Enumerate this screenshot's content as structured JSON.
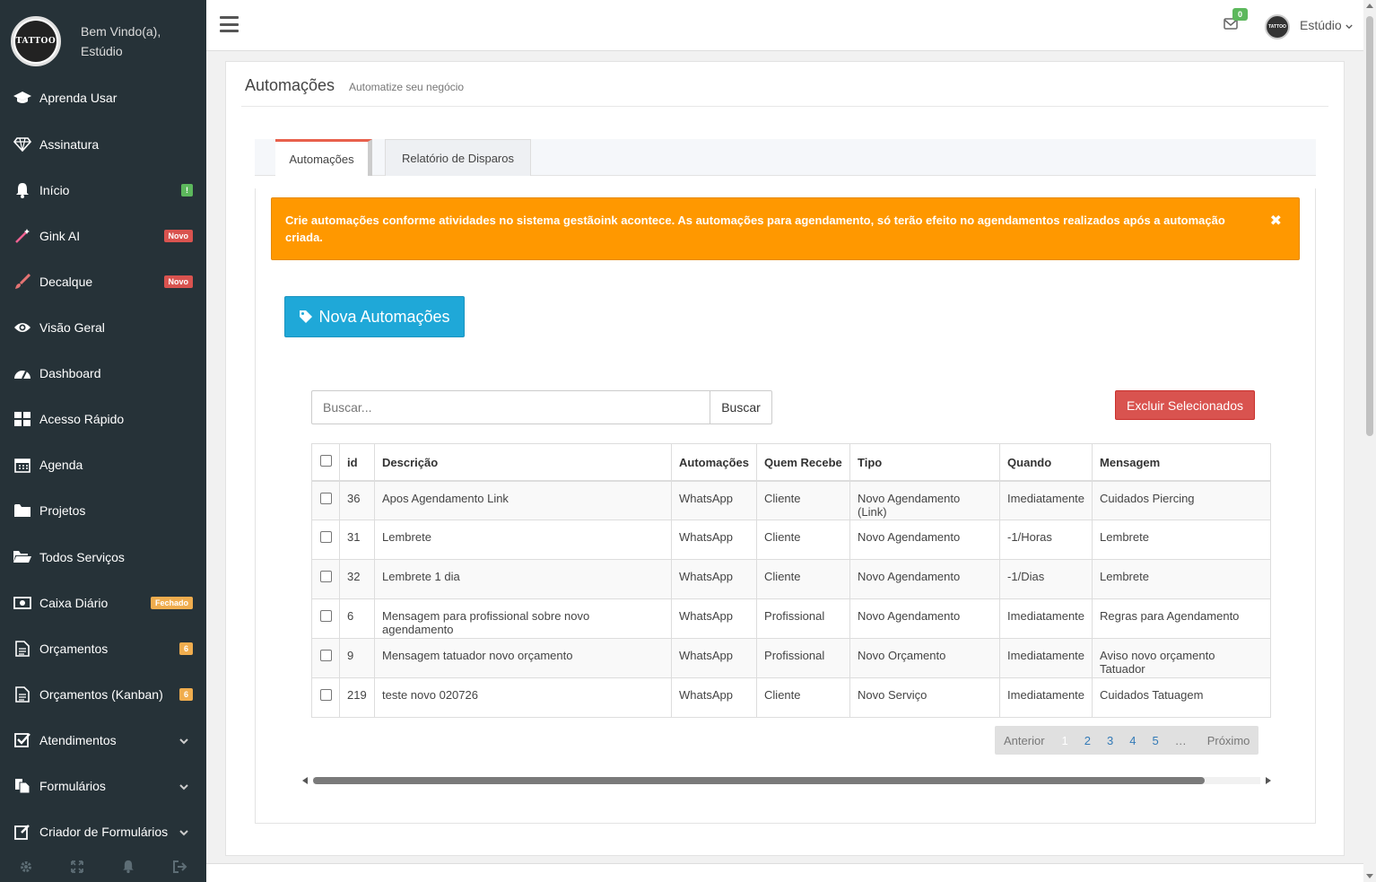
{
  "sidebar": {
    "welcome_line1": "Bem Vindo(a),",
    "welcome_line2": "Estúdio",
    "logo_text": "TATTOO",
    "items": [
      {
        "label": "Aprenda Usar",
        "icon": "graduation-cap-icon"
      },
      {
        "label": "Assinatura",
        "icon": "diamond-icon"
      },
      {
        "label": "Início",
        "icon": "bell-icon",
        "badge": "!"
      },
      {
        "label": "Gink AI",
        "icon": "magic-wand-icon",
        "badge": "Novo"
      },
      {
        "label": "Decalque",
        "icon": "paintbrush-icon",
        "badge": "Novo"
      },
      {
        "label": "Visão Geral",
        "icon": "eye-icon"
      },
      {
        "label": "Dashboard",
        "icon": "dashboard-icon"
      },
      {
        "label": "Acesso Rápido",
        "icon": "grid-icon"
      },
      {
        "label": "Agenda",
        "icon": "calendar-icon"
      },
      {
        "label": "Projetos",
        "icon": "folder-icon"
      },
      {
        "label": "Todos Serviços",
        "icon": "folder-open-icon"
      },
      {
        "label": "Caixa Diário",
        "icon": "money-icon",
        "badge": "Fechado"
      },
      {
        "label": "Orçamentos",
        "icon": "document-icon",
        "badge": "6"
      },
      {
        "label": "Orçamentos (Kanban)",
        "icon": "document-icon",
        "badge": "6"
      },
      {
        "label": "Atendimentos",
        "icon": "check-square-icon"
      },
      {
        "label": "Formulários",
        "icon": "files-icon"
      },
      {
        "label": "Criador de Formulários",
        "icon": "edit-icon"
      }
    ],
    "footer_icons": [
      "gear-icon",
      "fullscreen-icon",
      "bell-icon",
      "logout-icon"
    ]
  },
  "topbar": {
    "mail_count": "0",
    "user_name": "Estúdio",
    "avatar_text": "TATTOO"
  },
  "page": {
    "title": "Automações",
    "subtitle": "Automatize seu negócio",
    "tabs": [
      "Automações",
      "Relatório de Disparos"
    ],
    "alert": "Crie automações conforme atividades no sistema gestãoink acontece. As automações para agendamento, só terão efeito no agendamentos realizados após a automação criada.",
    "alert_close": "✖",
    "new_button": "Nova Automações",
    "search_placeholder": "Buscar...",
    "search_button": "Buscar",
    "delete_button": "Excluir Selecionados"
  },
  "table": {
    "headers": [
      "id",
      "Descrição",
      "Automações",
      "Quem Recebe",
      "Tipo",
      "Quando",
      "Mensagem"
    ],
    "rows": [
      [
        "36",
        "Apos Agendamento Link",
        "WhatsApp",
        "Cliente",
        "Novo Agendamento (Link)",
        "Imediatamente",
        "Cuidados Piercing"
      ],
      [
        "31",
        "Lembrete",
        "WhatsApp",
        "Cliente",
        "Novo Agendamento",
        "-1/Horas",
        "Lembrete"
      ],
      [
        "32",
        "Lembrete 1 dia",
        "WhatsApp",
        "Cliente",
        "Novo Agendamento",
        "-1/Dias",
        "Lembrete"
      ],
      [
        "6",
        "Mensagem para profissional sobre novo agendamento",
        "WhatsApp",
        "Profissional",
        "Novo Agendamento",
        "Imediatamente",
        "Regras para Agendamento"
      ],
      [
        "9",
        "Mensagem tatuador novo orçamento",
        "WhatsApp",
        "Profissional",
        "Novo Orçamento",
        "Imediatamente",
        "Aviso novo orçamento Tatuador"
      ],
      [
        "219",
        "teste novo 020726",
        "WhatsApp",
        "Cliente",
        "Novo Serviço",
        "Imediatamente",
        "Cuidados Tatuagem"
      ]
    ]
  },
  "pagination": {
    "prev": "Anterior",
    "pages": [
      "1",
      "2",
      "3",
      "4",
      "5"
    ],
    "ellipsis": "…",
    "next": "Próximo",
    "current": "1"
  },
  "colors": {
    "sidebar_bg": "#263238",
    "alert": "#ff9800",
    "primary_button": "#1fa8d8",
    "danger_button": "#d9534f",
    "active_tab_accent": "#e8604c"
  }
}
